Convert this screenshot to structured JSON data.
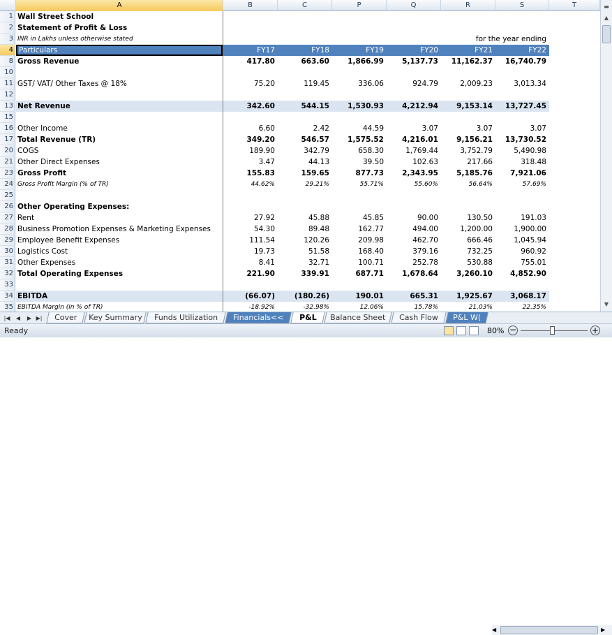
{
  "columns": [
    "A",
    "B",
    "C",
    "P",
    "Q",
    "R",
    "S",
    "T"
  ],
  "header": {
    "col_particulars": "Particulars",
    "years": [
      "FY17",
      "FY18",
      "FY19",
      "FY20",
      "FY21",
      "FY22"
    ]
  },
  "titles": {
    "r1": "Wall Street School",
    "r2": "Statement of Profit & Loss",
    "r3": "INR in Lakhs unless otherwise stated",
    "r3_right": "for the year ending"
  },
  "rows": [
    {
      "num": "8",
      "label": "Gross Revenue",
      "style": "b",
      "vals": [
        "417.80",
        "663.60",
        "1,866.99",
        "5,137.73",
        "11,162.37",
        "16,740.79"
      ]
    },
    {
      "num": "10",
      "label": "",
      "style": "",
      "vals": []
    },
    {
      "num": "11",
      "label": "GST/ VAT/ Other Taxes @ 18%",
      "style": "",
      "vals": [
        "75.20",
        "119.45",
        "336.06",
        "924.79",
        "2,009.23",
        "3,013.34"
      ]
    },
    {
      "num": "12",
      "label": "",
      "style": "",
      "vals": []
    },
    {
      "num": "13",
      "label": "Net Revenue",
      "style": "b band",
      "vals": [
        "342.60",
        "544.15",
        "1,530.93",
        "4,212.94",
        "9,153.14",
        "13,727.45"
      ]
    },
    {
      "num": "15",
      "label": "",
      "style": "",
      "vals": []
    },
    {
      "num": "16",
      "label": "Other Income",
      "style": "",
      "vals": [
        "6.60",
        "2.42",
        "44.59",
        "3.07",
        "3.07",
        "3.07"
      ]
    },
    {
      "num": "17",
      "label": "Total Revenue (TR)",
      "style": "b",
      "vals": [
        "349.20",
        "546.57",
        "1,575.52",
        "4,216.01",
        "9,156.21",
        "13,730.52"
      ]
    },
    {
      "num": "20",
      "label": "COGS",
      "style": "",
      "vals": [
        "189.90",
        "342.79",
        "658.30",
        "1,769.44",
        "3,752.79",
        "5,490.98"
      ]
    },
    {
      "num": "21",
      "label": "Other Direct Expenses",
      "style": "",
      "vals": [
        "3.47",
        "44.13",
        "39.50",
        "102.63",
        "217.66",
        "318.48"
      ]
    },
    {
      "num": "23",
      "label": "Gross Profit",
      "style": "b",
      "vals": [
        "155.83",
        "159.65",
        "877.73",
        "2,343.95",
        "5,185.76",
        "7,921.06"
      ]
    },
    {
      "num": "24",
      "label": "Gross Profit Margin (% of TR)",
      "style": "i",
      "vals": [
        "44.62%",
        "29.21%",
        "55.71%",
        "55.60%",
        "56.64%",
        "57.69%"
      ]
    },
    {
      "num": "25",
      "label": "",
      "style": "",
      "vals": []
    },
    {
      "num": "26",
      "label": "Other Operating Expenses:",
      "style": "b",
      "vals": []
    },
    {
      "num": "27",
      "label": "Rent",
      "style": "",
      "vals": [
        "27.92",
        "45.88",
        "45.85",
        "90.00",
        "130.50",
        "191.03"
      ]
    },
    {
      "num": "28",
      "label": "Business Promotion Expenses & Marketing Expenses",
      "style": "",
      "vals": [
        "54.30",
        "89.48",
        "162.77",
        "494.00",
        "1,200.00",
        "1,900.00"
      ]
    },
    {
      "num": "29",
      "label": "Employee Benefit Expenses",
      "style": "",
      "vals": [
        "111.54",
        "120.26",
        "209.98",
        "462.70",
        "666.46",
        "1,045.94"
      ]
    },
    {
      "num": "30",
      "label": "Logistics Cost",
      "style": "",
      "vals": [
        "19.73",
        "51.58",
        "168.40",
        "379.16",
        "732.25",
        "960.92"
      ]
    },
    {
      "num": "31",
      "label": "Other Expenses",
      "style": "",
      "vals": [
        "8.41",
        "32.71",
        "100.71",
        "252.78",
        "530.88",
        "755.01"
      ]
    },
    {
      "num": "32",
      "label": "Total Operating Expenses",
      "style": "b",
      "vals": [
        "221.90",
        "339.91",
        "687.71",
        "1,678.64",
        "3,260.10",
        "4,852.90"
      ]
    },
    {
      "num": "33",
      "label": "",
      "style": "",
      "vals": []
    },
    {
      "num": "34",
      "label": "EBITDA",
      "style": "b band",
      "vals": [
        "(66.07)",
        "(180.26)",
        "190.01",
        "665.31",
        "1,925.67",
        "3,068.17"
      ]
    },
    {
      "num": "35",
      "label": "EBITDA Margin (in % of TR)",
      "style": "i",
      "vals": [
        "-18.92%",
        "-32.98%",
        "12.06%",
        "15.78%",
        "21.03%",
        "22.35%"
      ]
    }
  ],
  "tabs": [
    {
      "label": "Cover",
      "state": ""
    },
    {
      "label": "Key Summary",
      "state": ""
    },
    {
      "label": "Funds Utilization",
      "state": ""
    },
    {
      "label": "Financials<<",
      "state": "blue"
    },
    {
      "label": "P&L",
      "state": "active"
    },
    {
      "label": "Balance Sheet",
      "state": ""
    },
    {
      "label": "Cash Flow",
      "state": ""
    },
    {
      "label": "P&L W(",
      "state": "blue"
    }
  ],
  "status": {
    "ready": "Ready",
    "zoom": "80%"
  }
}
